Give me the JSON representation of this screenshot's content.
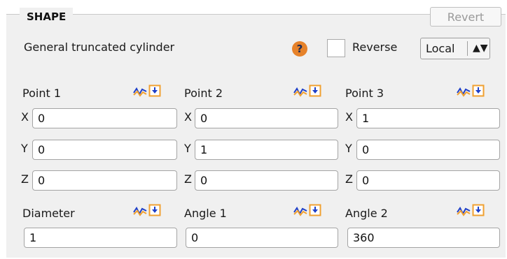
{
  "section": {
    "title": "SHAPE",
    "revert_label": "Revert"
  },
  "header": {
    "description": "General truncated cylinder",
    "help_glyph": "?",
    "reverse_label": "Reverse",
    "reverse_checked": false,
    "frame_select": "Local"
  },
  "points": [
    {
      "label": "Point 1",
      "x": "0",
      "y": "0",
      "z": "0"
    },
    {
      "label": "Point 2",
      "x": "0",
      "y": "1",
      "z": "0"
    },
    {
      "label": "Point 3",
      "x": "1",
      "y": "0",
      "z": "0"
    }
  ],
  "axes": {
    "x": "X",
    "y": "Y",
    "z": "Z"
  },
  "params": [
    {
      "label": "Diameter",
      "value": "1"
    },
    {
      "label": "Angle 1",
      "value": "0"
    },
    {
      "label": "Angle 2",
      "value": "360"
    }
  ],
  "colors": {
    "icon_orange": "#f0a030",
    "icon_blue": "#1e3fc8",
    "help_orange": "#e6822a"
  },
  "icons": {
    "graph": "graph-curve-icon",
    "pick": "pick-down-arrow-icon",
    "help": "help-icon"
  }
}
